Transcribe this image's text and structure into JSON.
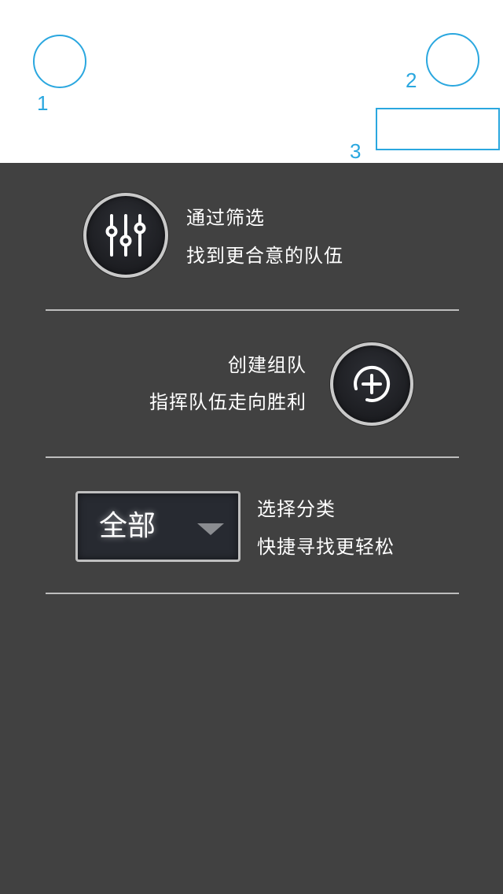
{
  "markers": {
    "marker_1": "1",
    "marker_2": "2",
    "marker_3": "3"
  },
  "tips": {
    "filter": {
      "line1": "通过筛选",
      "line2": "找到更合意的队伍",
      "icon": "sliders-icon"
    },
    "create_team": {
      "line1": "创建组队",
      "line2": "指挥队伍走向胜利",
      "icon": "plus-circle-icon"
    },
    "category": {
      "line1": "选择分类",
      "line2": "快捷寻找更轻松",
      "dropdown_value": "全部",
      "icon": "chevron-down-icon"
    }
  },
  "colors": {
    "accent": "#2aa7df",
    "overlay": "#414141",
    "divider": "#bdbdbd",
    "button_border": "#c9c9c9"
  }
}
